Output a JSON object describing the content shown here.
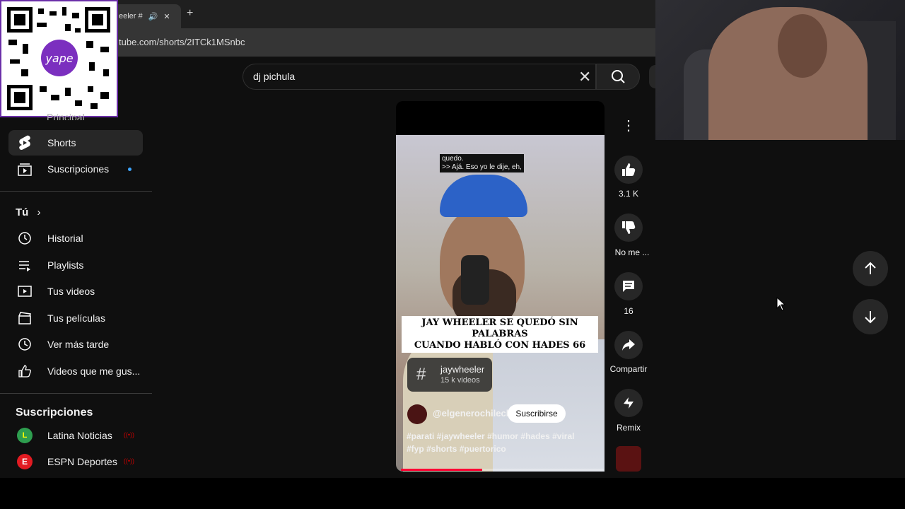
{
  "browser": {
    "tab_title": "eeler #",
    "url": "tube.com/shorts/2ITCk1MSnbc"
  },
  "search": {
    "value": "dj pichula"
  },
  "sidebar": {
    "partial_item": "Principal",
    "items": [
      {
        "label": "Shorts"
      },
      {
        "label": "Suscripciones"
      }
    ],
    "you_title": "Tú",
    "you_items": [
      {
        "label": "Historial"
      },
      {
        "label": "Playlists"
      },
      {
        "label": "Tus videos"
      },
      {
        "label": "Tus películas"
      },
      {
        "label": "Ver más tarde"
      },
      {
        "label": "Videos que me gus..."
      }
    ],
    "subs_title": "Suscripciones",
    "subs": [
      {
        "label": "Latina Noticias",
        "live": "((•))"
      },
      {
        "label": "ESPN Deportes",
        "live": "((•))"
      }
    ]
  },
  "short": {
    "caption_line1": "quedo.",
    "caption_line2": ">> Ajá. Eso yo le dije, eh,",
    "headline_line1": "JAY WHEELER SE QUEDÓ SIN PALABRAS",
    "headline_line2": "CUANDO HABLÓ CON HADES 66",
    "tag_name": "jaywheeler",
    "tag_count": "15 k videos",
    "channel": "@elgenerochilecl",
    "subscribe": "Suscribirse",
    "desc_line1": "#parati #jaywheeler #humor #hades #viral",
    "desc_line2": "#fyp #shorts #puertorico",
    "progress": 0.4
  },
  "actions": {
    "likes": "3.1 K",
    "dislike": "No me ...",
    "comments": "16",
    "share": "Compartir",
    "remix": "Remix"
  },
  "colors": {
    "accent": "#ff0033",
    "background": "#0f0f0f",
    "subscribe_bg": "#ffffff"
  }
}
